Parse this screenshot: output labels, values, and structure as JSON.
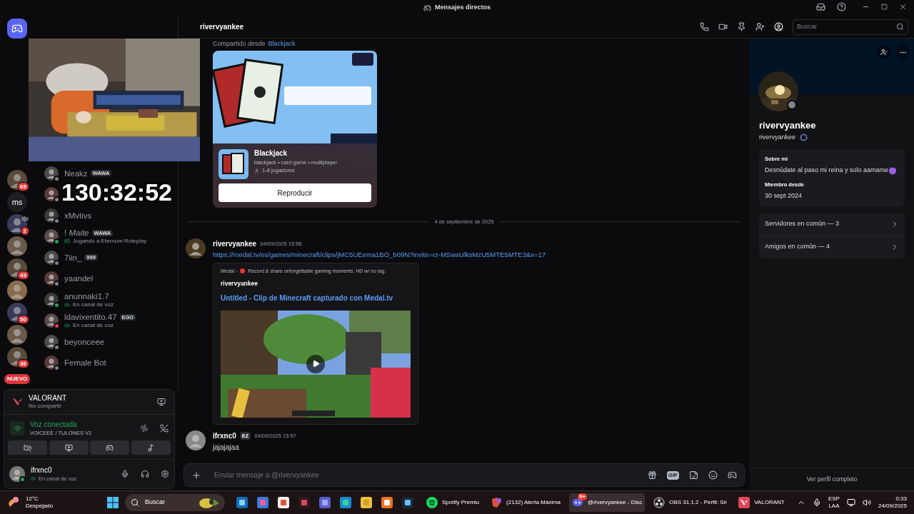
{
  "window": {
    "title": "Mensajes directos"
  },
  "overlay": {
    "timer": "130:32:52"
  },
  "servers": [
    {
      "kind": "avatar",
      "badge": "65",
      "in_voice": false
    },
    {
      "kind": "text",
      "label": "ms",
      "in_voice": false
    },
    {
      "kind": "avatar",
      "badge": "2",
      "in_voice": true
    },
    {
      "kind": "avatar",
      "in_voice": false
    },
    {
      "kind": "avatar",
      "badge": "43",
      "in_voice": false
    },
    {
      "kind": "avatar",
      "in_voice": false
    },
    {
      "kind": "avatar",
      "badge": "50",
      "in_voice": false
    },
    {
      "kind": "avatar",
      "in_voice": false
    },
    {
      "kind": "avatar",
      "badge": "36",
      "in_voice": false
    },
    {
      "kind": "new",
      "label": "NUEVO",
      "in_voice": false
    }
  ],
  "dms": [
    {
      "name": "Neakz",
      "tag": "WAWA",
      "color": "#80848e"
    },
    {
      "color": "#80848e"
    },
    {
      "name": "xMvtivs",
      "color": "#80848e"
    },
    {
      "name": "! *Maite*",
      "tag": "WAWA",
      "color": "#23a55a",
      "activity": {
        "kind": "game",
        "text": "Jugando a Eternum Roleplay"
      }
    },
    {
      "name": "7iin_",
      "tag": "999",
      "color": "#80848e"
    },
    {
      "name": "yaandel",
      "color": "#80848e"
    },
    {
      "name": "anunnaki1.7",
      "color": "#23a55a",
      "activity": {
        "kind": "voice",
        "text": "En canal de voz"
      }
    },
    {
      "name": "ldavixentito.47",
      "tag": "EGO",
      "color": "#f23f43",
      "activity": {
        "kind": "voice",
        "text": "En canal de voz"
      }
    },
    {
      "name": "beyonceee",
      "color": "#80848e"
    },
    {
      "name": "Female Bot",
      "color": "#80848e"
    }
  ],
  "activity_panel": {
    "title": "VALORANT",
    "subtitle": "No compartir"
  },
  "voice_panel": {
    "title": "Voz conectada",
    "channel": "VOICEEE / TULONES V2"
  },
  "user_panel": {
    "name": "ifrxnc0",
    "status_text": "En canal de voz",
    "color": "#23a55a"
  },
  "header": {
    "name": "rivervyankee",
    "profile_open": true,
    "search_placeholder": "Buscar"
  },
  "chat": [
    {
      "kind": "share",
      "prefix": "Compartido desde",
      "source": "Blackjack",
      "card": {
        "title": "Blackjack",
        "tags": "blackjack • card game • multiplayer",
        "players": "1-8 jugadores",
        "button": "Reproducir"
      }
    },
    {
      "kind": "divider",
      "text": "4 de septiembre de 2025"
    },
    {
      "kind": "message",
      "author": "rivervyankee",
      "time": "04/09/2025 15:56",
      "link": "https://medal.tv/es/games/minecraft/clips/jMC5UEema1BO_b09N?invite=cr-MSwxUlksMzU5MTE5MTE3&v=17",
      "embed": {
        "provider": "Medal -",
        "description": "Record & share unforgettable gaming moments. HD w/ no lag.",
        "author": "rivervyankee",
        "title": "Untitled - Clip de Minecraft capturado con Medal.tv"
      }
    },
    {
      "kind": "message",
      "author": "ifrxnc0",
      "tag": "EZ",
      "time": "04/09/2025 15:57",
      "text": "jajajajaa"
    }
  ],
  "composer": {
    "placeholder": "Enviar mensaje a @rivervyankee",
    "gif_label": "GIF"
  },
  "profile": {
    "display_name": "rivervyankee",
    "username": "rivervyankee",
    "color": "#80848e",
    "about_title": "Sobre mi",
    "about": "Desnúdate al paso mi reina y solo aamame",
    "member_title": "Miembro desde",
    "member_since": "30 sept 2024",
    "links": [
      "Servidores en común — 3",
      "Amigos en común — 4"
    ],
    "footer": "Ver perfil completo"
  },
  "taskbar": {
    "temp": "12°C",
    "weather": "Despejado",
    "search": "Buscar",
    "apps": [
      {
        "kind": "spotify",
        "label": "Spotify Premiu",
        "selected": false
      },
      {
        "kind": "browser",
        "label": "(2132) Alerta Máxima",
        "selected": false
      },
      {
        "kind": "discord",
        "label": "@rivervyankee - Disc",
        "badge": "9+",
        "selected": true
      },
      {
        "kind": "obs",
        "label": "OBS 31.1.2 - Perfil: Sir",
        "selected": false
      },
      {
        "kind": "game",
        "label": "VALORANT",
        "selected": false
      }
    ],
    "lang": "ESP",
    "layout": "LAA",
    "time": "0:33",
    "date": "24/09/2025"
  }
}
